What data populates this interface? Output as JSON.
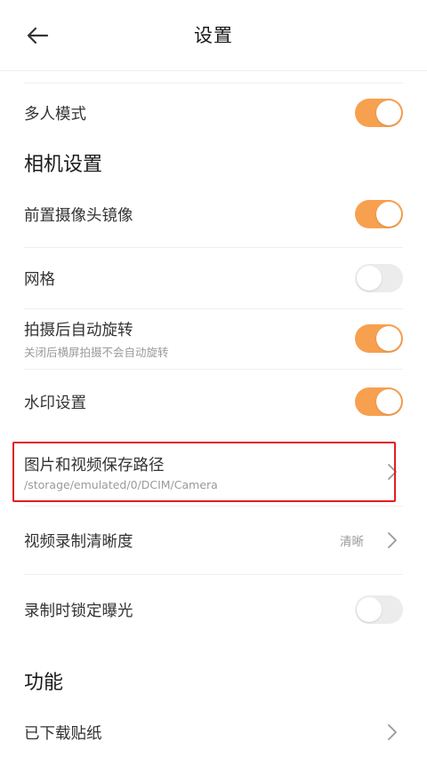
{
  "header": {
    "title": "设置"
  },
  "rows": {
    "multi_mode": {
      "label": "多人模式",
      "toggle": "on"
    },
    "front_mirror": {
      "label": "前置摄像头镜像",
      "toggle": "on"
    },
    "grid": {
      "label": "网格",
      "toggle": "off"
    },
    "auto_rotate": {
      "label": "拍摄后自动旋转",
      "sub": "关闭后横屏拍摄不会自动旋转",
      "toggle": "on"
    },
    "watermark": {
      "label": "水印设置",
      "toggle": "on"
    },
    "save_path": {
      "label": "图片和视频保存路径",
      "sub": "/storage/emulated/0/DCIM/Camera"
    },
    "video_quality": {
      "label": "视频录制清晰度",
      "value": "清晰"
    },
    "lock_exposure": {
      "label": "录制时锁定曝光",
      "toggle": "off"
    },
    "stickers": {
      "label": "已下载贴纸"
    }
  },
  "sections": {
    "camera": "相机设置",
    "features": "功能"
  },
  "colors": {
    "accent": "#f7a04f",
    "highlight": "#e02020",
    "toggle_off": "#ececec"
  }
}
